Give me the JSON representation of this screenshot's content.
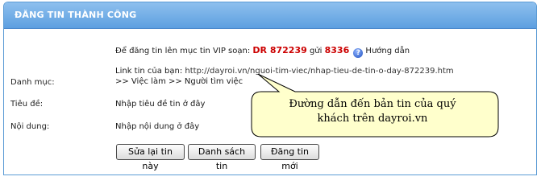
{
  "header": {
    "title": "ĐĂNG TIN THÀNH CÔNG"
  },
  "vip": {
    "prefix": "Để đăng tin lên mục tin VIP soạn:",
    "code": "DR 872239",
    "send_word": "gửi",
    "number": "8336",
    "help_label": "Hướng dẫn"
  },
  "link": {
    "label": "Link tin của bạn:",
    "url": "http://dayroi.vn/nguoi-tim-viec/nhap-tieu-de-tin-o-day-872239.htm"
  },
  "fields": {
    "category_label": "Danh mục:",
    "category_value": ">> Việc làm >> Người tìm việc",
    "title_label": "Tiêu đề:",
    "title_value": "Nhập tiêu đề tin ở đây",
    "content_label": "Nội dung:",
    "content_value": "Nhập nội dung ở đây"
  },
  "buttons": {
    "edit": "Sửa lại tin này",
    "list": "Danh sách tin",
    "new": "Đăng tin mới"
  },
  "callout": {
    "line1": "Đường dẫn đến bản tin của quý",
    "line2": "khách trên dayroi.vn",
    "fill_color": "#ffffcc"
  }
}
